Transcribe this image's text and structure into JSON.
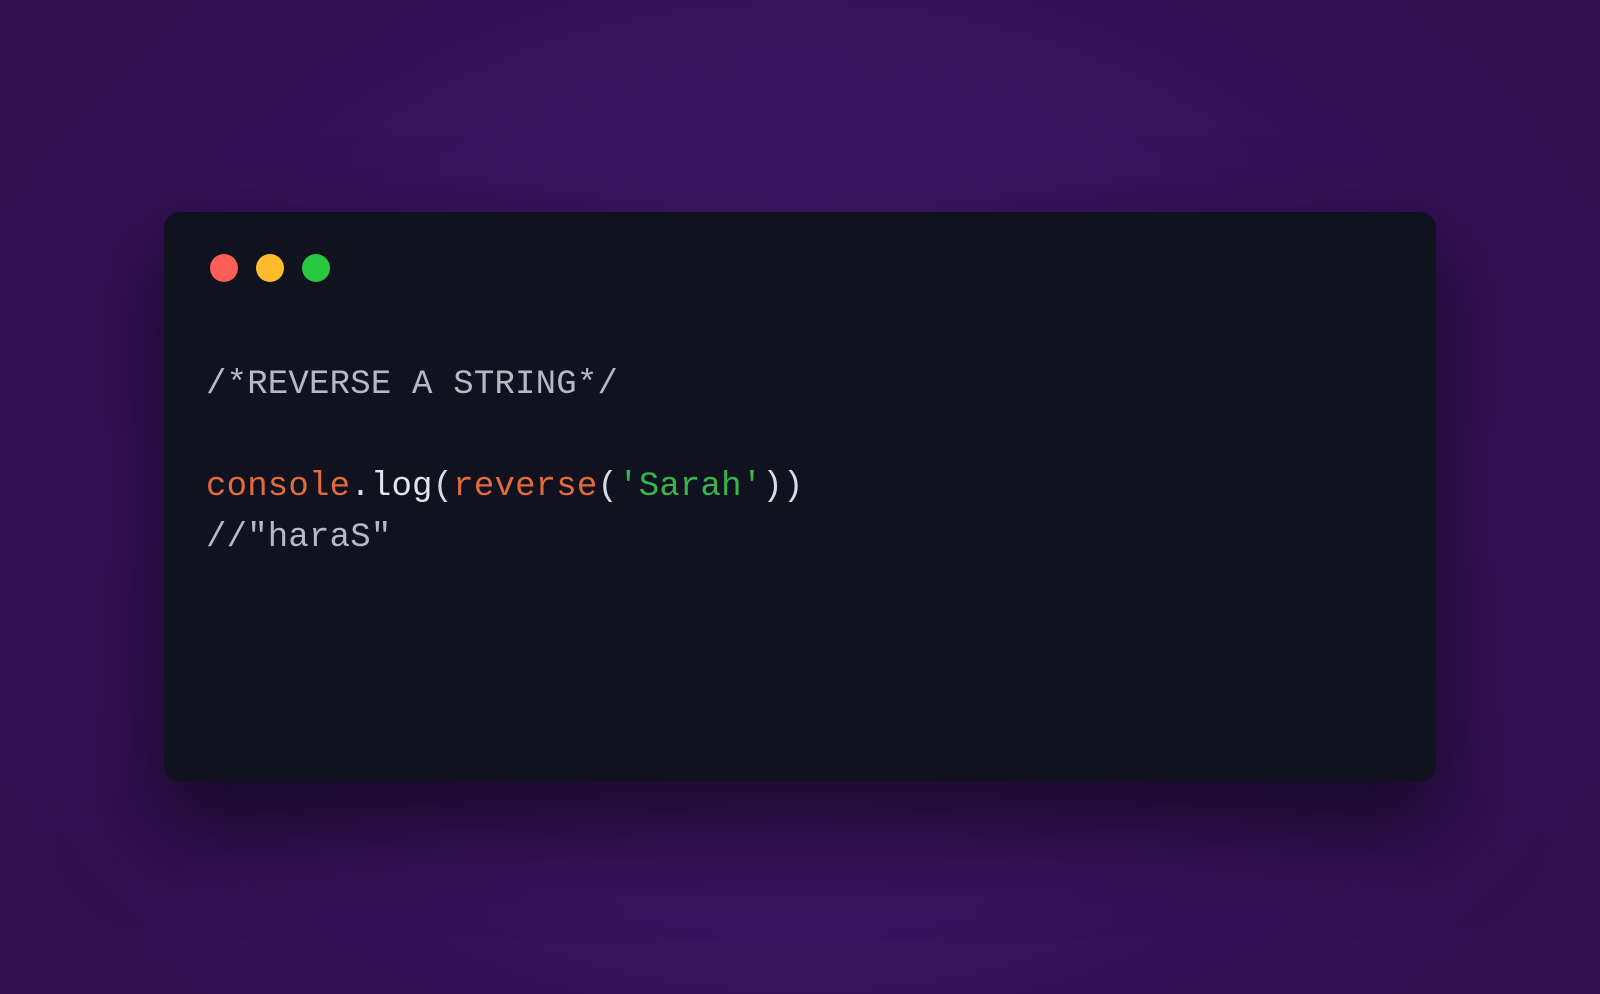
{
  "window": {
    "background_color": "#10131f",
    "page_background": "#3a1561"
  },
  "code": {
    "line1_comment": "/*REVERSE A STRING*/",
    "blank": "",
    "line3": {
      "obj": "console",
      "dot1": ".",
      "method": "log",
      "open_paren1": "(",
      "func": "reverse",
      "open_paren2": "(",
      "string": "'Sarah'",
      "close_paren2": ")",
      "close_paren1": ")"
    },
    "line4_comment": "//\"haraS\""
  }
}
